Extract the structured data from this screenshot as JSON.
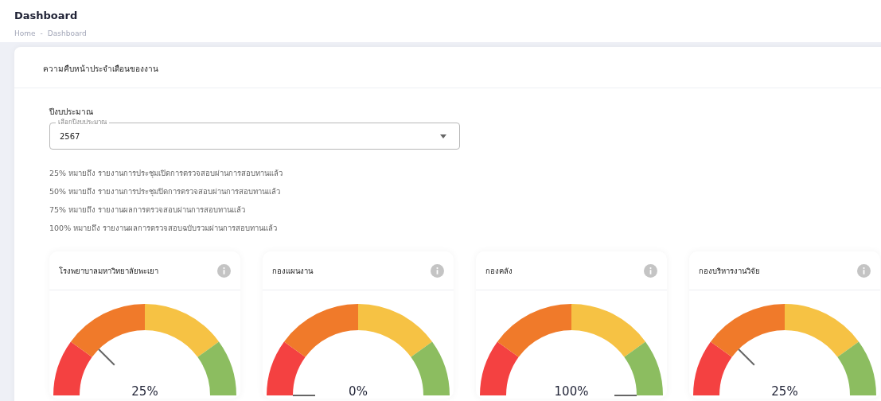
{
  "page": {
    "title": "Dashboard",
    "breadcrumb": [
      "Home",
      "Dashboard"
    ],
    "breadcrumb_separator": "-"
  },
  "panel": {
    "title": "ความคืบหน้าประจำเดือนของงาน",
    "budget": {
      "label": "ปีงบประมาณ",
      "placeholder": "เลือกปีงบประมาณ",
      "value": "2567"
    },
    "legend": [
      "25% หมายถึง รายงานการประชุมเปิดการตรวจสอบผ่านการสอบทานแล้ว",
      "50% หมายถึง รายงานการประชุมปิดการตรวจสอบผ่านการสอบทานแล้ว",
      "75% หมายถึง รายงานผลการตรวจสอบผ่านการสอบทานแล้ว",
      "100% หมายถึง รายงานผลการตรวจสอบฉบับรวมผ่านการสอบทานแล้ว"
    ],
    "gauges": [
      {
        "title": "โรงพยาบาลมหาวิทยาลัยพะเยา",
        "reading": "25%"
      },
      {
        "title": "กองแผนงาน",
        "reading": "0%"
      },
      {
        "title": "กองคลัง",
        "reading": "100%"
      },
      {
        "title": "กองบริหารงานวิจัย",
        "reading": "25%"
      }
    ]
  }
}
